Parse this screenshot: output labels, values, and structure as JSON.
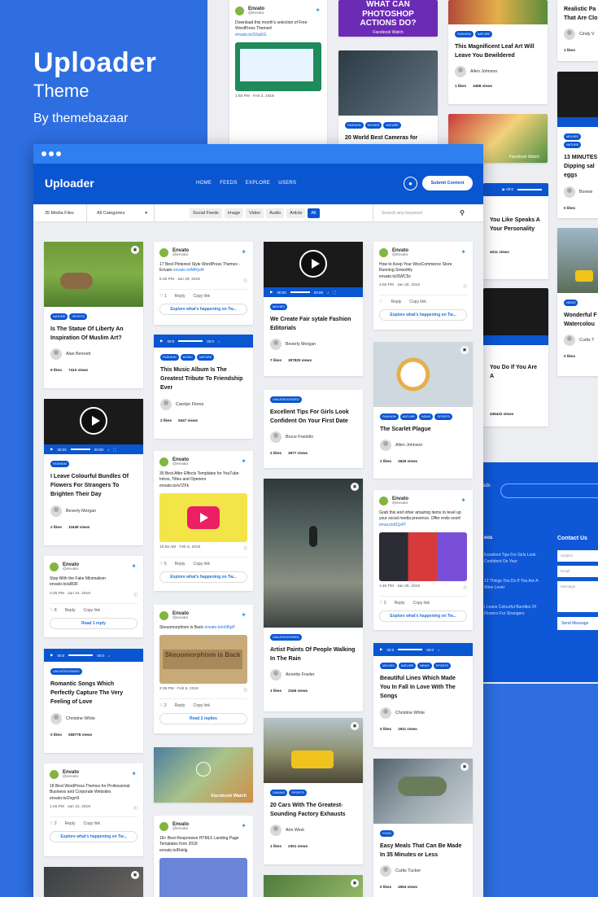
{
  "brand": {
    "title": "Uploader",
    "subtitle": "Theme",
    "by": "By themebazaar"
  },
  "app": {
    "logo": "Uploader",
    "menu": [
      "HOME",
      "FEEDS",
      "EXPLORE",
      "USERS"
    ],
    "submit": "Submit Content"
  },
  "filter": {
    "count": "35 Media Files",
    "category": "All Categories",
    "tabs": [
      "Social Feeds",
      "Image",
      "Video",
      "Audio",
      "Article",
      "All"
    ],
    "search_placeholder": "Search any keyword"
  },
  "icons": {
    "play": "play-icon",
    "volume": "volume-icon",
    "fullscreen": "fullscreen-icon",
    "twitter": "twitter-bird-icon",
    "search": "search-icon",
    "user": "user-icon",
    "photo": "photo-icon"
  },
  "colors": {
    "accent": "#0a55d0",
    "background": "#2e6ee0",
    "tag": "#0a55d0",
    "twitter": "#1da1f2"
  },
  "back": {
    "a": "Realistic Pa",
    "b": "That Are Clo",
    "c": "Cindy V",
    "d": "13 MINUTES",
    "e": "Dipping sal",
    "f": "eggs",
    "g": "Bonnie",
    "h": "Wonderful F",
    "i": "Watercolou",
    "j": "Curtis T",
    "k": "WHAT CAN",
    "l": "PHOTOSHOP",
    "m": "ACTIONS DO?",
    "n": "Facebook Watch",
    "o": "This Magnificent Leaf Art Will",
    "p": "Leave You Bewildered",
    "q": "Allen Johnson",
    "r": "20 World Best Cameras for",
    "s": "Contact Us",
    "t": "You Like Speaks A",
    "u": "Your Personality",
    "v": "You Do If You Are A",
    "w": "Download this month's selection of Free WordPress Themes!",
    "x": "envato.to/SSqKG",
    "y": "1:50 PM · Feb 2, 2018",
    "z": "Send Message",
    "likes": "1 likes",
    "views": "3498 views",
    "l2": "0 likes",
    "v2": "4011 views",
    "v3": "436422 views",
    "f1": "Excellent Tips For Girls Look Confident On Your",
    "f2": "13 Things You Do If You Are A Wine Lover",
    "f3": "I Leave Colourful Bundles Of Flowers For Strangers",
    "ph1": "Subject",
    "ph2": "Email",
    "ph3": "Message",
    "tz": "eos",
    "tw": "eds"
  },
  "c1": {
    "tags": [
      "NATURE",
      "SPORTS"
    ],
    "title": "Is The Statue Of Liberty An Inspiration Of Muslim Art?",
    "author": "Alan Bennett",
    "likes": "9 likes",
    "views": "7410 views"
  },
  "c2": {
    "time1": "00:00",
    "time2": "00:00",
    "tags": [
      "FASHION"
    ],
    "title": "I Leave Colourful Bundles Of Flowers For Strangers To Brighten Their Day",
    "author": "Beverly Morgan",
    "likes": "2 likes",
    "views": "11649 views"
  },
  "c3": {
    "name": "Envato",
    "handle": "@envato",
    "text": "Stop With the Fake Minimalism",
    "link": "envato.to/aRl3F",
    "date": "3:25 PM · Jan 24, 2018",
    "like": "8",
    "reply": "Reply",
    "copy": "Copy link",
    "btn": "Read 1 reply"
  },
  "c4": {
    "time1": "00:0",
    "time2": "00:0",
    "tags": [
      "UNCATEGORIZED"
    ],
    "title": "Romantic Songs Which Perfectly Capture The Very Feeling of Love",
    "author": "Christine White",
    "likes": "0 likes",
    "views": "508778 views"
  },
  "c5": {
    "name": "Envato",
    "handle": "@envato",
    "text": "18 Best WordPress Themes for Professional Business and Corporate Websites",
    "link": "envato.to/2vgrr9",
    "date": "1:45 PM · Jan 31, 2018",
    "like": "2",
    "reply": "Reply",
    "copy": "Copy link",
    "btn": "Explore what's happening on Tw..."
  },
  "d1": {
    "name": "Envato",
    "handle": "@envato",
    "text": "17 Best Pinterest Style WordPress Themes - Envato",
    "link": "envato.to/MRyd4",
    "date": "5:45 PM · Jan 29, 2018",
    "like": "1",
    "reply": "Reply",
    "copy": "Copy link",
    "btn": "Explore what's happening on Tw..."
  },
  "d2": {
    "time1": "00:0",
    "time2": "00:0",
    "tags": [
      "FASHION",
      "MUSIC",
      "NATURE"
    ],
    "title": "This Music Album Is The Greatest Tribute To Friendship Ever",
    "author": "Carolyn Flores",
    "likes": "2 likes",
    "views": "5447 views"
  },
  "d3": {
    "name": "Envato",
    "handle": "@envato",
    "text": "30 Best After Effects Templates for YouTube Intros, Titles and Openers",
    "link": "envato.to/a7ZFk",
    "date": "10:55 AM · Feb 6, 2018",
    "like": "5",
    "reply": "Reply",
    "copy": "Copy link",
    "btn": "Explore what's happening on Tw..."
  },
  "d4": {
    "name": "Envato",
    "handle": "@envato",
    "text": "Skeuomorphism Is Back",
    "link": "envato.to/o0l6pP",
    "img": "Skeuomorphism is Back",
    "date": "2:05 PM · Feb 6, 2018",
    "like": "2",
    "reply": "Reply",
    "copy": "Copy link",
    "btn": "Read 2 replies"
  },
  "d5": {
    "label": "Facebook Watch"
  },
  "d6": {
    "name": "Envato",
    "handle": "@envato",
    "text": "18+ Best Responsive HTML5 Landing Page Templates from 2018",
    "link": "envato.to/Rxklg"
  },
  "e1": {
    "time1": "00:00",
    "time2": "00:00",
    "tags": [
      "MOVIES"
    ],
    "title": "We Create Fair sytale Fashion Editorials",
    "author": "Beverly Morgan",
    "likes": "7 likes",
    "views": "307825 views"
  },
  "e2": {
    "tags": [
      "UNCATEGORIZED"
    ],
    "title": "Excellent Tips For Girls Look Confident On Your First Date",
    "author": "Bruce Franklin",
    "likes": "2 likes",
    "views": "3577 views"
  },
  "e3": {
    "tags": [
      "UNCATEGORIZED"
    ],
    "title": "Artist Paints Of People Walking In The Rain",
    "author": "Annette Fowler",
    "likes": "1 likes",
    "views": "2166 views"
  },
  "e4": {
    "tags": [
      "GAMING",
      "SPORTS"
    ],
    "title": "20 Cars With The Greatest-Sounding Factory Exhausts",
    "author": "Ann West",
    "likes": "1 likes",
    "views": "2301 views"
  },
  "f1": {
    "name": "Envato",
    "handle": "@envato",
    "text": "How to Keep Your WooCommerce Store Running Smoothly",
    "link": "envato.to/SWC5x",
    "date": "4:55 PM · Jan 30, 2018",
    "like": "",
    "reply": "Reply",
    "copy": "Copy link",
    "btn": "Explore what's happening on Tw..."
  },
  "f2": {
    "tags": [
      "FASHION",
      "NATURE",
      "NEWS",
      "SPORTS"
    ],
    "title": "The Scarlet Plague",
    "author": "Allen Johnson",
    "likes": "2 likes",
    "views": "3645 views"
  },
  "f3": {
    "name": "Envato",
    "handle": "@envato",
    "text": "Grab this and other amazing items to level up your social media presence. Offer ends soon!",
    "link": "enva.to/dCp4Y",
    "date": "1:40 PM · Jan 25, 2018",
    "like": "2",
    "reply": "Reply",
    "copy": "Copy link",
    "btn": "Explore what's happening on Tw..."
  },
  "f4": {
    "time1": "00:0",
    "time2": "00:0",
    "tags": [
      "MOVIES",
      "NATURE",
      "NEWS",
      "SPORTS"
    ],
    "title": "Beautiful Lines Which Made You In Fall In Love With The Songs",
    "author": "Christine White",
    "likes": "0 likes",
    "views": "1911 views"
  },
  "f5": {
    "tags": [
      "FOOD"
    ],
    "title": "Easy Meals That Can Be Made In 35 Minutes or Less",
    "author": "Curtis Tucker",
    "likes": "0 likes",
    "views": "4094 views"
  }
}
